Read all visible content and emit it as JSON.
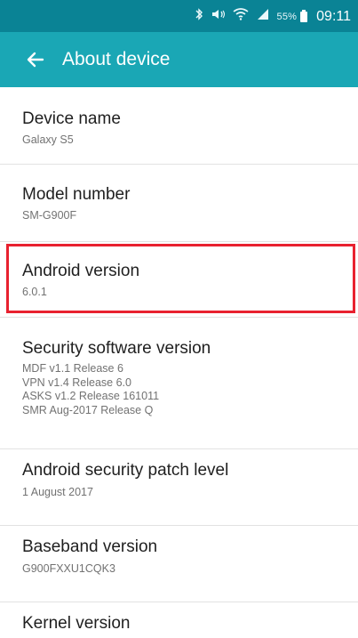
{
  "status_bar": {
    "battery_percent": "55%",
    "time": "09:11",
    "icons": [
      "bluetooth-icon",
      "sound-icon",
      "wifi-icon",
      "signal-icon",
      "battery-icon"
    ]
  },
  "app_bar": {
    "back_icon": "arrow-left-icon",
    "title": "About device"
  },
  "settings": {
    "device_name": {
      "title": "Device name",
      "value": "Galaxy S5"
    },
    "model_number": {
      "title": "Model number",
      "value": "SM-G900F"
    },
    "android_version": {
      "title": "Android version",
      "value": "6.0.1"
    },
    "security_software_version": {
      "title": "Security software version",
      "values": [
        "MDF v1.1 Release 6",
        "VPN v1.4 Release 6.0",
        "ASKS v1.2 Release 161011",
        "SMR Aug-2017 Release Q"
      ]
    },
    "android_security_patch_level": {
      "title": "Android security patch level",
      "value": "1 August 2017"
    },
    "baseband_version": {
      "title": "Baseband version",
      "value": "G900FXXU1CQK3"
    },
    "kernel_version": {
      "title": "Kernel version"
    }
  },
  "colors": {
    "status_bar": "#0a8395",
    "app_bar": "#1aa7b5",
    "highlight": "#e8212f",
    "title_text": "#1f1f1f",
    "value_text": "#727272"
  }
}
